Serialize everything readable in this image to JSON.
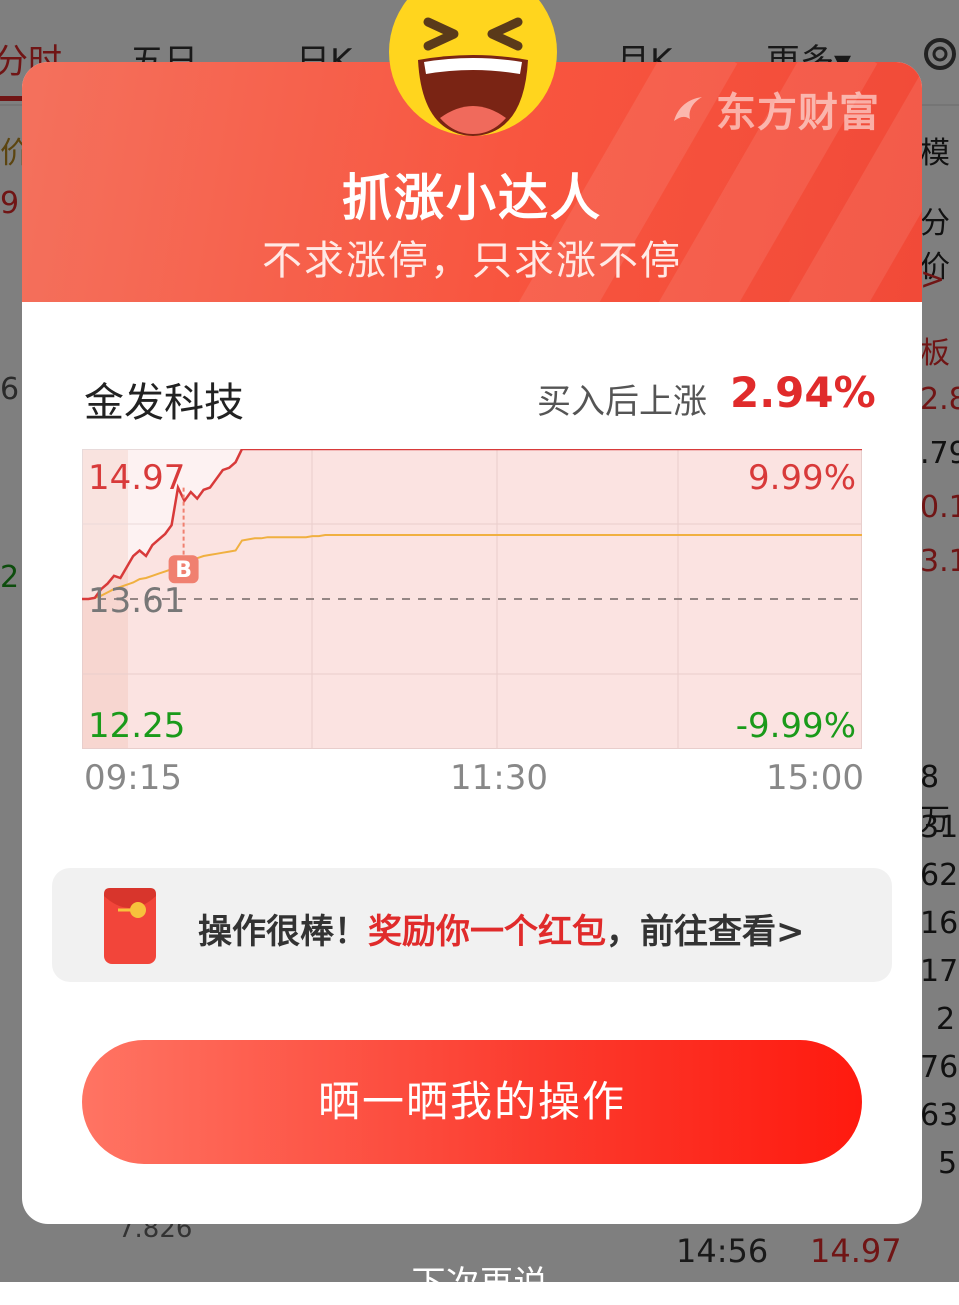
{
  "background": {
    "tabs": [
      "分时",
      "五日",
      "日K",
      "月K",
      "更多▾"
    ],
    "right_fragments": [
      "模",
      "分价",
      ">",
      "板",
      "2.8",
      ".79",
      "0.1",
      "3.1",
      "8万",
      "31",
      "62",
      "16",
      "17",
      "2",
      "76",
      "63",
      "5"
    ],
    "left_fragments": [
      "价",
      "9",
      "6",
      "2"
    ],
    "bottom_time": "14:56",
    "bottom_price": "14.97",
    "bottom_left_value": "7.826",
    "later_text": "下次再说"
  },
  "modal": {
    "brand": "东方财富",
    "title": "抓涨小达人",
    "subtitle": "不求涨停，只求涨不停",
    "stock_name": "金发科技",
    "gain_label": "买入后上涨",
    "gain_value": "2.94%",
    "reward": {
      "prefix": "操作很棒！",
      "highlight": "奖励你一个红包",
      "suffix": "，前往查看>"
    },
    "share_button": "晒一晒我的操作",
    "colors": {
      "header": "#f8553f",
      "up": "#e02b2b",
      "down": "#1a9a1a",
      "avg_line": "#f0b040"
    }
  },
  "chart_data": {
    "type": "line",
    "y_labels": {
      "top_price": "14.97",
      "base_price": "13.61",
      "bottom_price": "12.25",
      "top_pct": "9.99%",
      "bottom_pct": "-9.99%"
    },
    "x_labels": [
      "09:15",
      "11:30",
      "15:00"
    ],
    "ylim": [
      12.25,
      14.97
    ],
    "base": 13.61,
    "buy_marker": "B",
    "buy_index": 14,
    "series": [
      {
        "values": [
          13.61,
          13.61,
          13.62,
          13.7,
          13.75,
          13.82,
          13.8,
          13.9,
          14.0,
          14.05,
          14.0,
          14.1,
          14.15,
          14.2,
          14.28,
          14.62,
          14.5,
          14.58,
          14.52,
          14.6,
          14.62,
          14.7,
          14.78,
          14.8,
          14.85,
          14.97,
          14.97,
          14.97,
          14.97,
          14.97,
          14.97,
          14.97,
          14.97,
          14.97,
          14.97,
          14.97,
          14.97,
          14.97,
          14.97,
          14.97,
          14.97
        ]
      },
      {
        "values": [
          13.61,
          13.61,
          13.62,
          13.64,
          13.67,
          13.7,
          13.72,
          13.74,
          13.76,
          13.79,
          13.8,
          13.82,
          13.84,
          13.86,
          13.88,
          13.93,
          13.95,
          13.97,
          13.98,
          14.0,
          14.01,
          14.02,
          14.03,
          14.04,
          14.05,
          14.14,
          14.15,
          14.16,
          14.16,
          14.17,
          14.17,
          14.17,
          14.17,
          14.17,
          14.17,
          14.17,
          14.18,
          14.18,
          14.19,
          14.19,
          14.19
        ]
      }
    ]
  }
}
